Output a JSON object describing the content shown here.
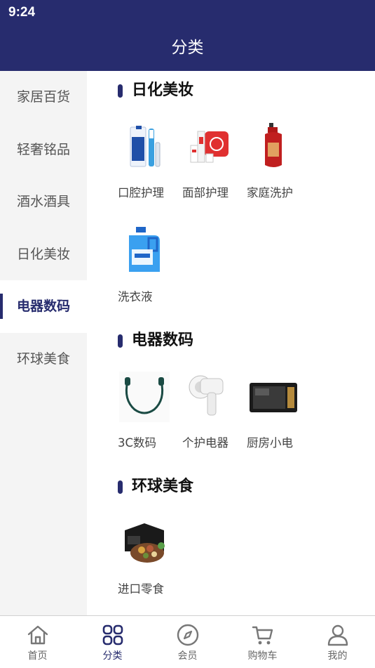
{
  "status_bar": {
    "time": "9:24"
  },
  "header": {
    "title": "分类"
  },
  "sidebar": {
    "items": [
      {
        "label": "家居百货",
        "active": false
      },
      {
        "label": "轻奢铭品",
        "active": false
      },
      {
        "label": "酒水酒具",
        "active": false
      },
      {
        "label": "日化美妆",
        "active": false
      },
      {
        "label": "电器数码",
        "active": true
      },
      {
        "label": "环球美食",
        "active": false
      }
    ]
  },
  "sections": [
    {
      "title": "日化美妆",
      "items": [
        {
          "label": "口腔护理",
          "image": "toothpaste-image"
        },
        {
          "label": "面部护理",
          "image": "skincare-set-image"
        },
        {
          "label": "家庭洗护",
          "image": "shampoo-bottle-image"
        },
        {
          "label": "洗衣液",
          "image": "detergent-bottle-image"
        }
      ]
    },
    {
      "title": "电器数码",
      "items": [
        {
          "label": "3C数码",
          "image": "earphones-image"
        },
        {
          "label": "个护电器",
          "image": "hair-dryer-image"
        },
        {
          "label": "厨房小电",
          "image": "microwave-image"
        }
      ]
    },
    {
      "title": "环球美食",
      "items": [
        {
          "label": "进口零食",
          "image": "nuts-gift-box-image"
        }
      ]
    }
  ],
  "tabbar": {
    "tabs": [
      {
        "label": "首页",
        "icon": "home-icon",
        "active": false
      },
      {
        "label": "分类",
        "icon": "category-grid-icon",
        "active": true
      },
      {
        "label": "会员",
        "icon": "compass-icon",
        "active": false
      },
      {
        "label": "购物车",
        "icon": "cart-icon",
        "active": false
      },
      {
        "label": "我的",
        "icon": "user-icon",
        "active": false
      }
    ]
  },
  "colors": {
    "primary": "#272c6e",
    "sidebar_bg": "#f4f4f4",
    "text": "#444444"
  }
}
